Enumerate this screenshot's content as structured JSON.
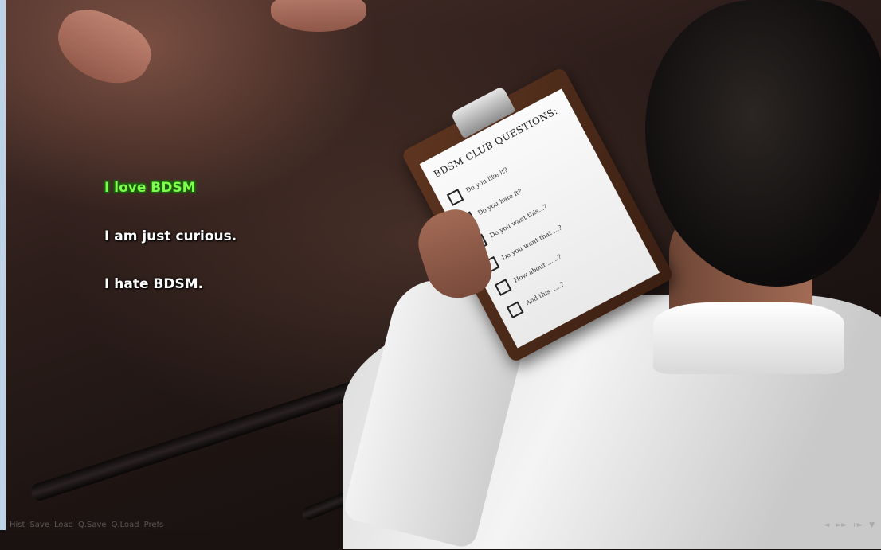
{
  "menu": {
    "choices": [
      {
        "label": "I love BDSM"
      },
      {
        "label": "I am just curious."
      },
      {
        "label": "I hate BDSM."
      }
    ]
  },
  "quick_menu": [
    "Hist",
    "Save",
    "Load",
    "Q.Save",
    "Q.Load",
    "Prefs"
  ],
  "skip_controls": [
    "◄",
    "►►",
    "ıı►",
    "▼"
  ],
  "clipboard": {
    "title": "BDSM  CLUB  QUESTIONS:",
    "questions": [
      "Do you like it?",
      "Do you hate it?",
      "Do you want this...?",
      "Do you want that ...?",
      "How about ......?",
      "And this .....?"
    ]
  },
  "colors": {
    "selected_choice": "#7cff4a",
    "choice_text": "#ffffff"
  }
}
